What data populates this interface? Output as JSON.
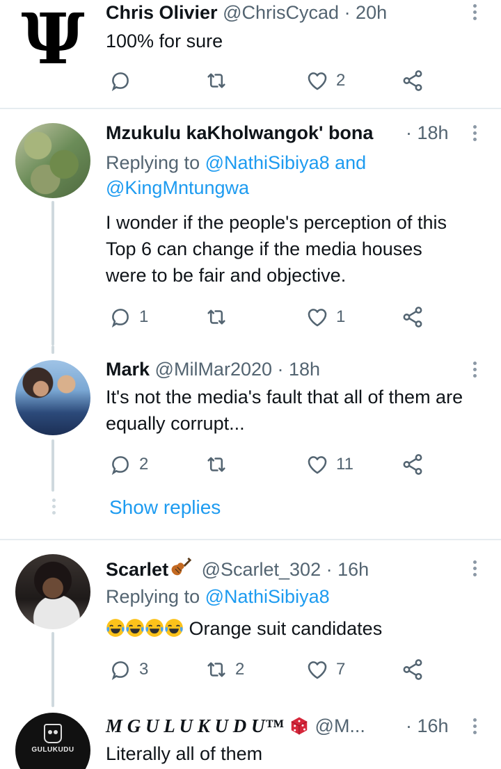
{
  "tweets": [
    {
      "name": "Chris Olivier",
      "handle": "@ChrisCycad",
      "time": "· 20h",
      "text": "100% for sure",
      "replies": "",
      "retweets": "",
      "likes": "2"
    },
    {
      "name": "Mzukulu kaKholwangok' bona",
      "time": "· 18h",
      "replying_prefix": "Replying to",
      "replying_to_1": "@NathiSibiya8",
      "replying_and": "and",
      "replying_to_2": "@KingMntungwa",
      "text": "I wonder if the people's perception of this Top 6 can change if the media houses were to be fair and objective.",
      "replies": "1",
      "retweets": "",
      "likes": "1"
    },
    {
      "name": "Mark",
      "handle": "@MilMar2020",
      "time": "· 18h",
      "text": "It's  not the media's fault that all of them are equally corrupt...",
      "replies": "2",
      "retweets": "",
      "likes": "11"
    },
    {
      "name": "Scarlet",
      "handle": "@Scarlet_302",
      "time": "· 16h",
      "replying_prefix": "Replying to",
      "replying_to_1": "@NathiSibiya8",
      "text": "Orange suit candidates",
      "replies": "3",
      "retweets": "2",
      "likes": "7"
    },
    {
      "name": "M G U L U K U D U™",
      "handle": "@M...",
      "time": "· 16h",
      "text": "Literally all of them",
      "avatar_text": "GULUKUDU"
    }
  ],
  "show_replies": "Show replies",
  "avatar_1_symbol": "Ψ",
  "colors": {
    "link": "#1d9bf0",
    "muted": "#536471",
    "icon": "#536471",
    "divider": "#e6ecf0"
  },
  "icons": [
    "reply-icon",
    "retweet-icon",
    "like-icon",
    "share-icon",
    "more-icon",
    "violin-emoji",
    "dice-emoji",
    "crying-laughing-emoji"
  ]
}
